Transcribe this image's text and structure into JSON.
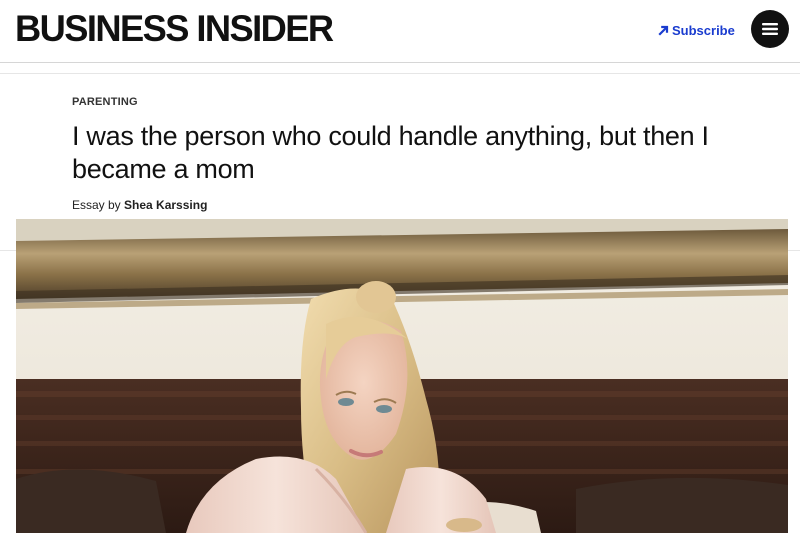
{
  "header": {
    "logo_text": "BUSINESS INSIDER",
    "subscribe_label": "Subscribe",
    "subscribe_icon": "arrow-up-right-icon",
    "menu_icon": "hamburger-menu-icon",
    "accent_color": "#1a3ccf"
  },
  "article": {
    "category": "PARENTING",
    "headline": "I was the person who could handle anything, but then I became a mom",
    "byline_prefix": "Essay by ",
    "author": "Shea Karssing"
  },
  "hero_image": {
    "subject": "photo-woman-blonde-hair-pink-blazer"
  }
}
